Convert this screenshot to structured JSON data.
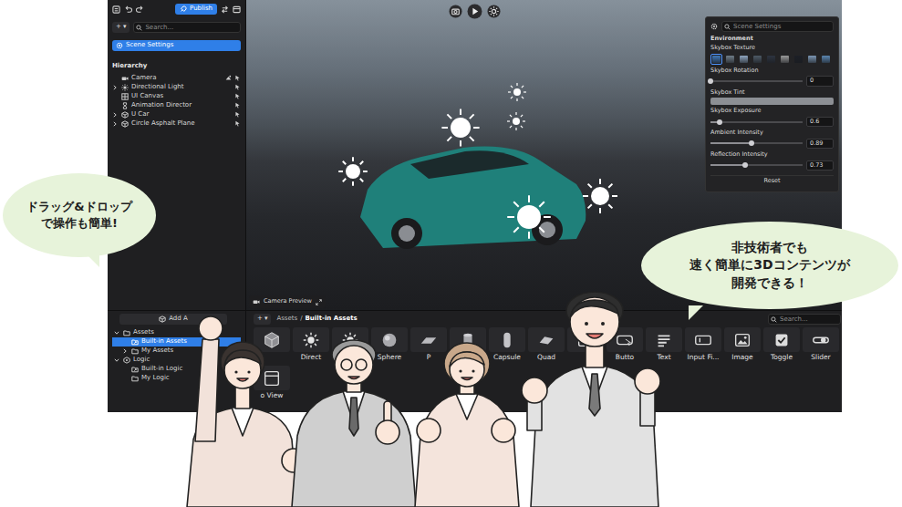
{
  "editor_toolbar": {
    "publish": "Publish"
  },
  "hierarchy_panel": {
    "add": "+",
    "add_caret": "▾",
    "search": {
      "placeholder": "Search..."
    },
    "scene_settings": {
      "label": "Scene Settings",
      "selected": true
    },
    "title": "Hierarchy",
    "items": [
      {
        "label": "Camera",
        "kind": "camera",
        "expandable": false,
        "selected": false
      },
      {
        "label": "Directional Light",
        "kind": "light",
        "expandable": true,
        "expanded": false,
        "selected": false
      },
      {
        "label": "UI Canvas",
        "kind": "canvas",
        "expandable": false,
        "selected": false
      },
      {
        "label": "Animation Director",
        "kind": "director",
        "expandable": false,
        "selected": false
      },
      {
        "label": "U Car",
        "kind": "object",
        "expandable": true,
        "expanded": false,
        "selected": false
      },
      {
        "label": "Circle Asphalt Plane",
        "kind": "object",
        "expandable": true,
        "expanded": false,
        "selected": false
      }
    ]
  },
  "viewport": {
    "preview_tab": "Camera Preview"
  },
  "scene_settings": {
    "search": {
      "placeholder": "Scene Settings"
    },
    "section": "Environment",
    "texture_label": "Skybox Texture",
    "textures": [
      {
        "color": "#3f78b8",
        "selected": true
      },
      {
        "color": "#6f7d88",
        "selected": false
      },
      {
        "color": "#8fa6c0",
        "selected": false
      },
      {
        "color": "#4d5a66",
        "selected": false
      },
      {
        "color": "#2d3440",
        "selected": false
      },
      {
        "color": "#9a9a9a",
        "selected": false
      },
      {
        "color": "#1c1f26",
        "selected": false
      },
      {
        "color": "#7c97b4",
        "selected": false
      },
      {
        "color": "#5b86b0",
        "selected": false
      }
    ],
    "properties": [
      {
        "label": "Skybox Rotation",
        "kind": "slider",
        "level": 0,
        "value": "0"
      },
      {
        "label": "Skybox Tint",
        "kind": "color",
        "color": "#8c8f94"
      },
      {
        "label": "Skybox Exposure",
        "kind": "slider",
        "level": 0.1,
        "value": "0.6"
      },
      {
        "label": "Ambient Intensity",
        "kind": "slider",
        "level": 0.45,
        "value": "0.89"
      },
      {
        "label": "Reflection Intensity",
        "kind": "slider",
        "level": 0.38,
        "value": "0.73"
      }
    ],
    "reset": "Reset"
  },
  "assets_panel": {
    "add_button": "Add A",
    "tree": [
      {
        "label": "Assets",
        "kind": "folder",
        "depth": 0,
        "expandable": true,
        "expanded": true,
        "selected": false
      },
      {
        "label": "Built-in Assets",
        "kind": "folder-link",
        "depth": 1,
        "expandable": false,
        "selected": true
      },
      {
        "label": "My Assets",
        "kind": "folder",
        "depth": 1,
        "expandable": true,
        "expanded": false,
        "selected": false
      },
      {
        "label": "Logic",
        "kind": "logic",
        "depth": 0,
        "expandable": true,
        "expanded": true,
        "selected": false
      },
      {
        "label": "Built-in Logic",
        "kind": "folder-link",
        "depth": 1,
        "expandable": false,
        "selected": false
      },
      {
        "label": "My Logic",
        "kind": "folder",
        "depth": 1,
        "expandable": false,
        "selected": false
      }
    ],
    "add": "+",
    "add_caret": "▾",
    "breadcrumb": [
      "Assets",
      "Built-in Assets"
    ],
    "separator": "/",
    "search": {
      "placeholder": "Search..."
    },
    "tiles": [
      {
        "label": "",
        "kind": "cube"
      },
      {
        "label": "Direct",
        "kind": "light"
      },
      {
        "label": "",
        "kind": "light"
      },
      {
        "label": "Sphere",
        "kind": "sphere"
      },
      {
        "label": "P",
        "kind": "plane"
      },
      {
        "label": "",
        "kind": "cylinder"
      },
      {
        "label": "Capsule",
        "kind": "capsule"
      },
      {
        "label": "Quad",
        "kind": "quad"
      },
      {
        "label": "",
        "kind": "panel"
      },
      {
        "label": "Butto",
        "kind": "button"
      },
      {
        "label": "Text",
        "kind": "text"
      },
      {
        "label": "Input Fi...",
        "kind": "input"
      },
      {
        "label": "Image",
        "kind": "image"
      },
      {
        "label": "Toggle",
        "kind": "toggle"
      },
      {
        "label": "Slider",
        "kind": "slider"
      },
      {
        "label": "o View",
        "kind": "view"
      }
    ]
  },
  "callouts": [
    {
      "lines": [
        "ドラッグ&ドロップ",
        "で操作も簡単!"
      ]
    },
    {
      "lines": [
        "非技術者でも",
        "速く簡単に3Dコンテンツが",
        "開発できる！"
      ]
    }
  ]
}
